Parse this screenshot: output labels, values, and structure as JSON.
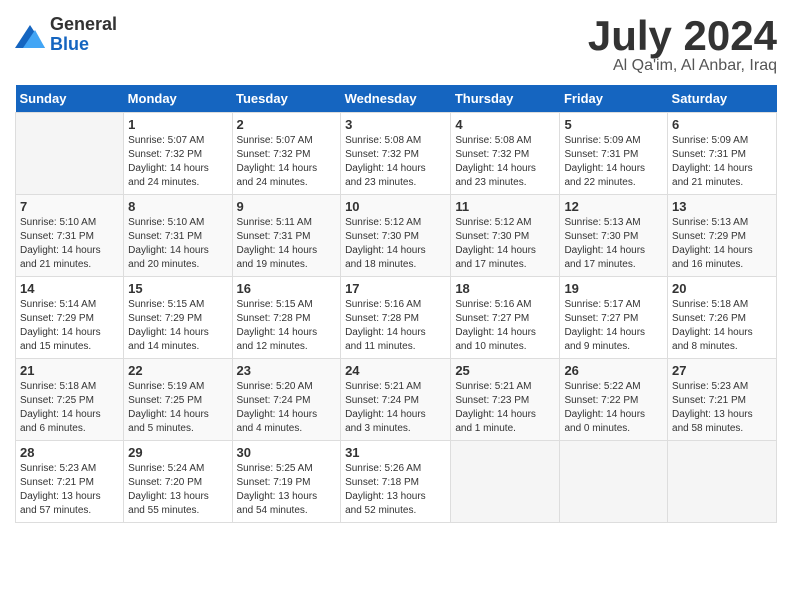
{
  "logo": {
    "general": "General",
    "blue": "Blue"
  },
  "title": "July 2024",
  "location": "Al Qa'im, Al Anbar, Iraq",
  "headers": [
    "Sunday",
    "Monday",
    "Tuesday",
    "Wednesday",
    "Thursday",
    "Friday",
    "Saturday"
  ],
  "weeks": [
    [
      {
        "day": "",
        "info": ""
      },
      {
        "day": "1",
        "info": "Sunrise: 5:07 AM\nSunset: 7:32 PM\nDaylight: 14 hours\nand 24 minutes."
      },
      {
        "day": "2",
        "info": "Sunrise: 5:07 AM\nSunset: 7:32 PM\nDaylight: 14 hours\nand 24 minutes."
      },
      {
        "day": "3",
        "info": "Sunrise: 5:08 AM\nSunset: 7:32 PM\nDaylight: 14 hours\nand 23 minutes."
      },
      {
        "day": "4",
        "info": "Sunrise: 5:08 AM\nSunset: 7:32 PM\nDaylight: 14 hours\nand 23 minutes."
      },
      {
        "day": "5",
        "info": "Sunrise: 5:09 AM\nSunset: 7:31 PM\nDaylight: 14 hours\nand 22 minutes."
      },
      {
        "day": "6",
        "info": "Sunrise: 5:09 AM\nSunset: 7:31 PM\nDaylight: 14 hours\nand 21 minutes."
      }
    ],
    [
      {
        "day": "7",
        "info": "Sunrise: 5:10 AM\nSunset: 7:31 PM\nDaylight: 14 hours\nand 21 minutes."
      },
      {
        "day": "8",
        "info": "Sunrise: 5:10 AM\nSunset: 7:31 PM\nDaylight: 14 hours\nand 20 minutes."
      },
      {
        "day": "9",
        "info": "Sunrise: 5:11 AM\nSunset: 7:31 PM\nDaylight: 14 hours\nand 19 minutes."
      },
      {
        "day": "10",
        "info": "Sunrise: 5:12 AM\nSunset: 7:30 PM\nDaylight: 14 hours\nand 18 minutes."
      },
      {
        "day": "11",
        "info": "Sunrise: 5:12 AM\nSunset: 7:30 PM\nDaylight: 14 hours\nand 17 minutes."
      },
      {
        "day": "12",
        "info": "Sunrise: 5:13 AM\nSunset: 7:30 PM\nDaylight: 14 hours\nand 17 minutes."
      },
      {
        "day": "13",
        "info": "Sunrise: 5:13 AM\nSunset: 7:29 PM\nDaylight: 14 hours\nand 16 minutes."
      }
    ],
    [
      {
        "day": "14",
        "info": "Sunrise: 5:14 AM\nSunset: 7:29 PM\nDaylight: 14 hours\nand 15 minutes."
      },
      {
        "day": "15",
        "info": "Sunrise: 5:15 AM\nSunset: 7:29 PM\nDaylight: 14 hours\nand 14 minutes."
      },
      {
        "day": "16",
        "info": "Sunrise: 5:15 AM\nSunset: 7:28 PM\nDaylight: 14 hours\nand 12 minutes."
      },
      {
        "day": "17",
        "info": "Sunrise: 5:16 AM\nSunset: 7:28 PM\nDaylight: 14 hours\nand 11 minutes."
      },
      {
        "day": "18",
        "info": "Sunrise: 5:16 AM\nSunset: 7:27 PM\nDaylight: 14 hours\nand 10 minutes."
      },
      {
        "day": "19",
        "info": "Sunrise: 5:17 AM\nSunset: 7:27 PM\nDaylight: 14 hours\nand 9 minutes."
      },
      {
        "day": "20",
        "info": "Sunrise: 5:18 AM\nSunset: 7:26 PM\nDaylight: 14 hours\nand 8 minutes."
      }
    ],
    [
      {
        "day": "21",
        "info": "Sunrise: 5:18 AM\nSunset: 7:25 PM\nDaylight: 14 hours\nand 6 minutes."
      },
      {
        "day": "22",
        "info": "Sunrise: 5:19 AM\nSunset: 7:25 PM\nDaylight: 14 hours\nand 5 minutes."
      },
      {
        "day": "23",
        "info": "Sunrise: 5:20 AM\nSunset: 7:24 PM\nDaylight: 14 hours\nand 4 minutes."
      },
      {
        "day": "24",
        "info": "Sunrise: 5:21 AM\nSunset: 7:24 PM\nDaylight: 14 hours\nand 3 minutes."
      },
      {
        "day": "25",
        "info": "Sunrise: 5:21 AM\nSunset: 7:23 PM\nDaylight: 14 hours\nand 1 minute."
      },
      {
        "day": "26",
        "info": "Sunrise: 5:22 AM\nSunset: 7:22 PM\nDaylight: 14 hours\nand 0 minutes."
      },
      {
        "day": "27",
        "info": "Sunrise: 5:23 AM\nSunset: 7:21 PM\nDaylight: 13 hours\nand 58 minutes."
      }
    ],
    [
      {
        "day": "28",
        "info": "Sunrise: 5:23 AM\nSunset: 7:21 PM\nDaylight: 13 hours\nand 57 minutes."
      },
      {
        "day": "29",
        "info": "Sunrise: 5:24 AM\nSunset: 7:20 PM\nDaylight: 13 hours\nand 55 minutes."
      },
      {
        "day": "30",
        "info": "Sunrise: 5:25 AM\nSunset: 7:19 PM\nDaylight: 13 hours\nand 54 minutes."
      },
      {
        "day": "31",
        "info": "Sunrise: 5:26 AM\nSunset: 7:18 PM\nDaylight: 13 hours\nand 52 minutes."
      },
      {
        "day": "",
        "info": ""
      },
      {
        "day": "",
        "info": ""
      },
      {
        "day": "",
        "info": ""
      }
    ]
  ]
}
